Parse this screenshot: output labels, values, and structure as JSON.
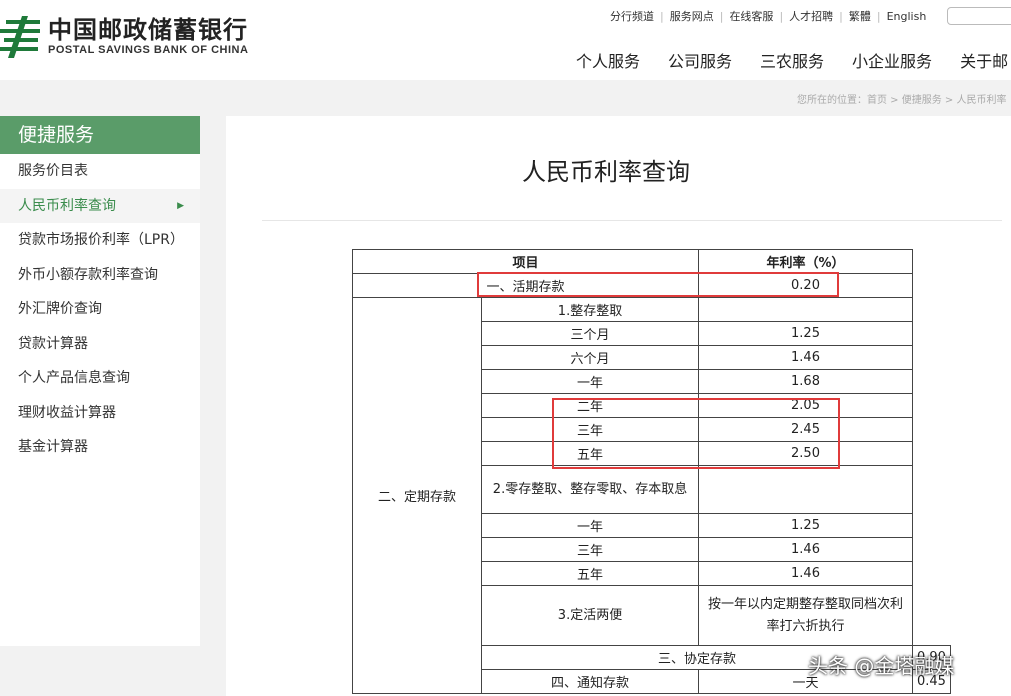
{
  "header": {
    "logo_cn": "中国邮政储蓄银行",
    "logo_en": "POSTAL SAVINGS BANK OF CHINA",
    "util_links": [
      "分行频道",
      "服务网点",
      "在线客服",
      "人才招聘",
      "繁體",
      "English"
    ],
    "main_nav": [
      "个人服务",
      "公司服务",
      "三农服务",
      "小企业服务",
      "关于邮"
    ]
  },
  "breadcrumb": "您所在的位置：首页 > 便捷服务 > 人民币利率",
  "sidebar": {
    "title": "便捷服务",
    "items": [
      {
        "label": "服务价目表"
      },
      {
        "label": "人民币利率查询"
      },
      {
        "label": "贷款市场报价利率（LPR）"
      },
      {
        "label": "外币小额存款利率查询"
      },
      {
        "label": "外汇牌价查询"
      },
      {
        "label": "贷款计算器"
      },
      {
        "label": "个人产品信息查询"
      },
      {
        "label": "理财收益计算器"
      },
      {
        "label": "基金计算器"
      }
    ],
    "active_arrow": "▶"
  },
  "content": {
    "title": "人民币利率查询",
    "table": {
      "head_item": "项目",
      "head_rate": "年利率（%）",
      "demand_label": "一、活期存款",
      "demand_rate": "0.20",
      "fixed_label": "二、定期存款",
      "lump_label": "1.整存整取",
      "lump_rows": [
        {
          "term": "三个月",
          "rate": "1.25"
        },
        {
          "term": "六个月",
          "rate": "1.46"
        },
        {
          "term": "一年",
          "rate": "1.68"
        },
        {
          "term": "二年",
          "rate": "2.05"
        },
        {
          "term": "三年",
          "rate": "2.45"
        },
        {
          "term": "五年",
          "rate": "2.50"
        }
      ],
      "part_label": "2.零存整取、整存零取、存本取息",
      "part_rows": [
        {
          "term": "一年",
          "rate": "1.25"
        },
        {
          "term": "三年",
          "rate": "1.46"
        },
        {
          "term": "五年",
          "rate": "1.46"
        }
      ],
      "flex_label": "3.定活两便",
      "flex_rate": "按一年以内定期整存整取同档次利率打六折执行",
      "agreement_label": "三、协定存款",
      "agreement_rate": "0.90",
      "notice_label": "四、通知存款",
      "notice_term": "一天",
      "notice_rate": "0.45"
    }
  },
  "watermark": "头条 @金塔融媒",
  "colors": {
    "brand_green": "#5a9c69",
    "highlight_red": "#e03b3b"
  }
}
